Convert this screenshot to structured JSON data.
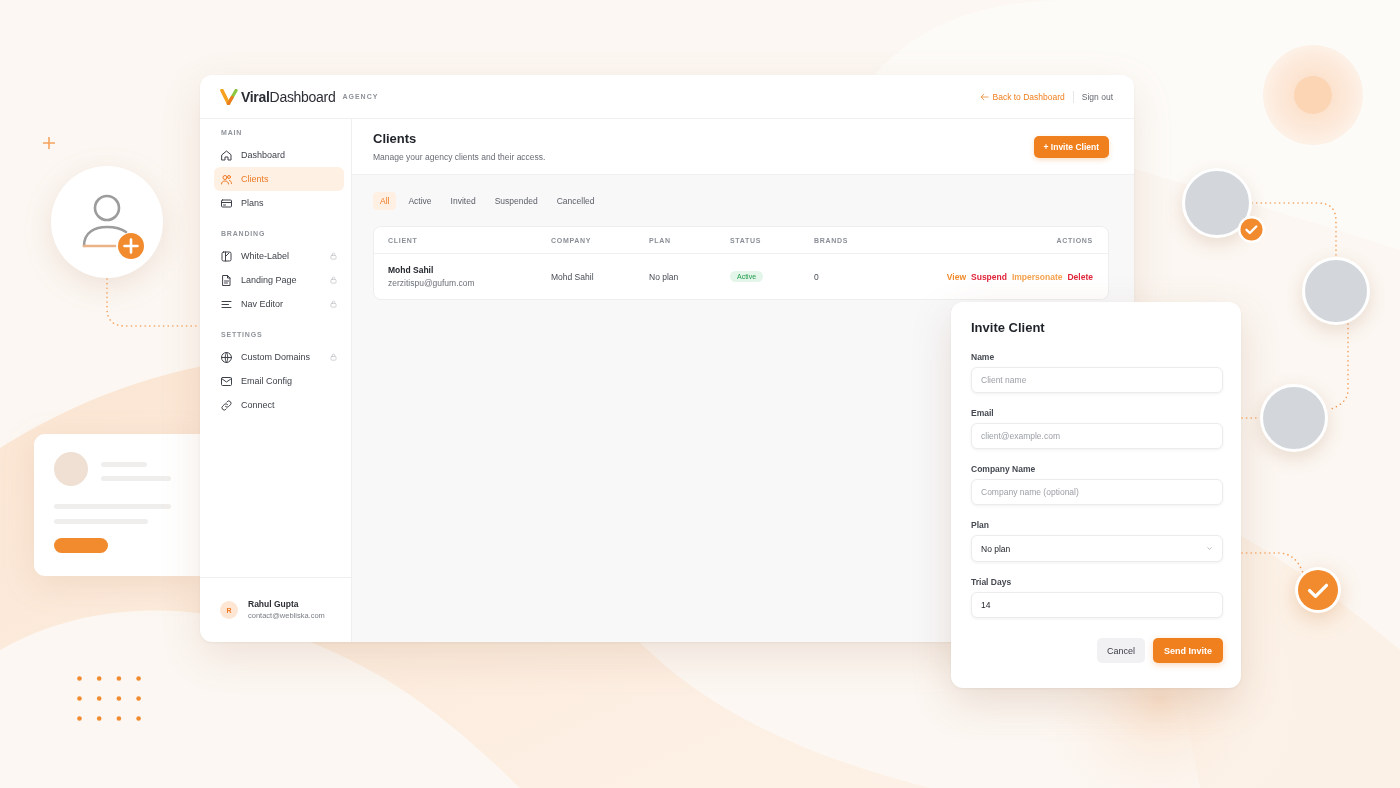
{
  "app": {
    "logo_text": "**Viral**Dashboard",
    "logo_tag": "AGENCY",
    "header_links": [
      {
        "label": "Back to Dashboard",
        "kind": "back"
      },
      {
        "label": "Sign out",
        "kind": "plain"
      }
    ],
    "sidebar": {
      "sections": [
        {
          "title": "MAIN",
          "items": [
            {
              "label": "Dashboard",
              "selected": false,
              "locked": false
            },
            {
              "label": "Clients",
              "selected": true,
              "locked": false
            },
            {
              "label": "Plans",
              "selected": false,
              "locked": false
            }
          ]
        },
        {
          "title": "BRANDING",
          "items": [
            {
              "label": "White-Label",
              "selected": false,
              "locked": true
            },
            {
              "label": "Landing Page",
              "selected": false,
              "locked": true
            },
            {
              "label": "Nav Editor",
              "selected": false,
              "locked": true
            }
          ]
        },
        {
          "title": "SETTINGS",
          "items": [
            {
              "label": "Custom Domains",
              "selected": false,
              "locked": true
            },
            {
              "label": "Email Config",
              "selected": false,
              "locked": false
            },
            {
              "label": "Connect",
              "selected": false,
              "locked": false
            }
          ]
        }
      ],
      "user": {
        "initial": "R",
        "name": "Rahul Gupta",
        "email": "contact@webliska.com"
      }
    },
    "page": {
      "title": "Clients",
      "subtitle": "Manage your agency clients and their access.",
      "primary_button": "+ Invite Client"
    },
    "filters": [
      {
        "label": "All",
        "selected": true
      },
      {
        "label": "Active",
        "selected": false
      },
      {
        "label": "Invited",
        "selected": false
      },
      {
        "label": "Suspended",
        "selected": false
      },
      {
        "label": "Cancelled",
        "selected": false
      }
    ],
    "table": {
      "columns": [
        "CLIENT",
        "COMPANY",
        "PLAN",
        "STATUS",
        "BRANDS",
        "ACTIONS"
      ],
      "rows": [
        {
          "client": "Mohd Sahil",
          "email": "zerzitispu@gufum.com",
          "company": "Mohd Sahil",
          "plan": "No plan",
          "status": "Active",
          "brands": "0",
          "actions": [
            {
              "label": "View",
              "color": "#f08a2c"
            },
            {
              "label": "Suspend",
              "color": "#e0263a"
            },
            {
              "label": "Impersonate",
              "color": "#f5a24e"
            },
            {
              "label": "Delete",
              "color": "#e0263a"
            }
          ]
        }
      ]
    }
  },
  "dialog": {
    "title": "Invite Client",
    "fields": [
      {
        "label": "Name",
        "kind": "input",
        "placeholder": "Client name"
      },
      {
        "label": "Email",
        "kind": "input",
        "placeholder": "client@example.com"
      },
      {
        "label": "Company Name",
        "kind": "input",
        "placeholder": "Company name (optional)"
      },
      {
        "label": "Plan",
        "kind": "select",
        "value": "No plan"
      },
      {
        "label": "Trial Days",
        "kind": "input",
        "value": "14"
      }
    ],
    "buttons": [
      {
        "label": "Cancel",
        "kind": "secondary"
      },
      {
        "label": "Send Invite",
        "kind": "primary"
      }
    ]
  },
  "avatars": [
    {
      "verified": true
    },
    {
      "verified": false
    },
    {
      "verified": false
    }
  ]
}
